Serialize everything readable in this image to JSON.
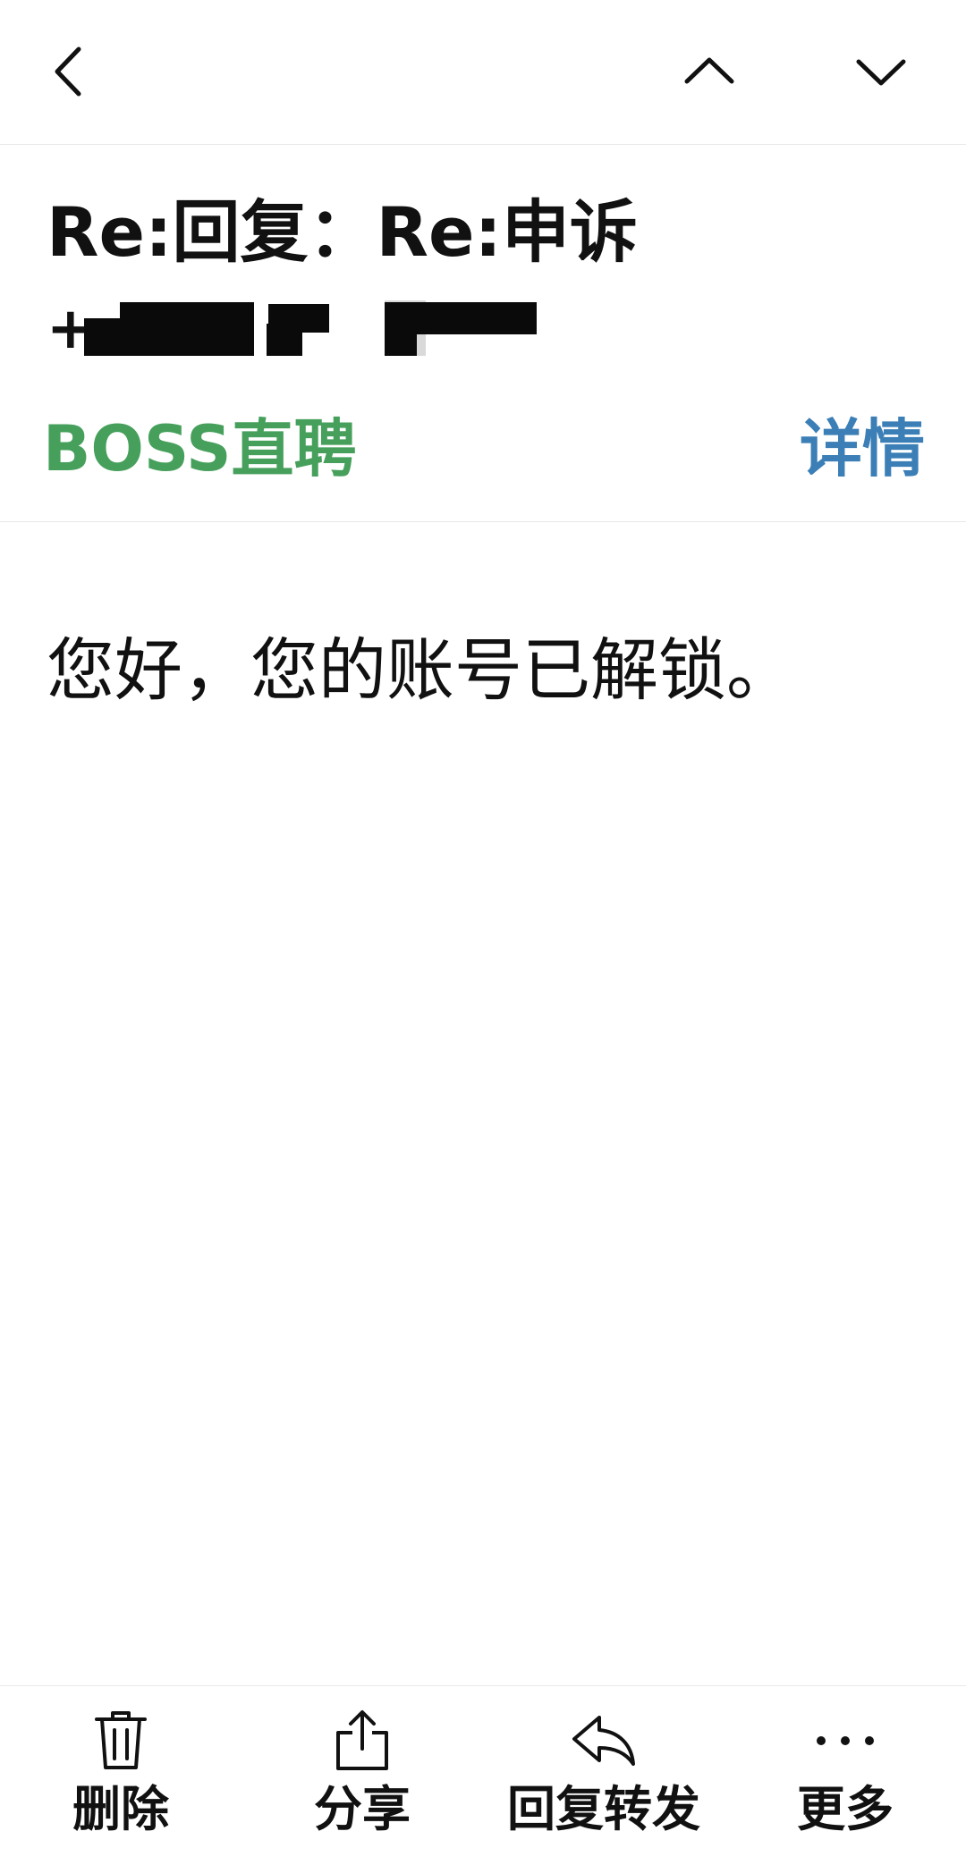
{
  "subject": {
    "title": "Re:回复：Re:申诉",
    "sender_prefix": "+"
  },
  "sender": {
    "name": "BOSS直聘",
    "details_label": "详情",
    "name_color": "#46a05c",
    "details_color": "#3b7fb6"
  },
  "body": {
    "text": "您好，您的账号已解锁。"
  },
  "toolbar": {
    "delete_label": "删除",
    "share_label": "分享",
    "reply_label": "回复转发",
    "more_label": "更多"
  },
  "icons": {
    "back": "chevron-left-icon",
    "prev": "chevron-up-icon",
    "next": "chevron-down-icon",
    "delete": "trash-icon",
    "share": "share-icon",
    "reply": "reply-icon",
    "more": "more-icon"
  }
}
